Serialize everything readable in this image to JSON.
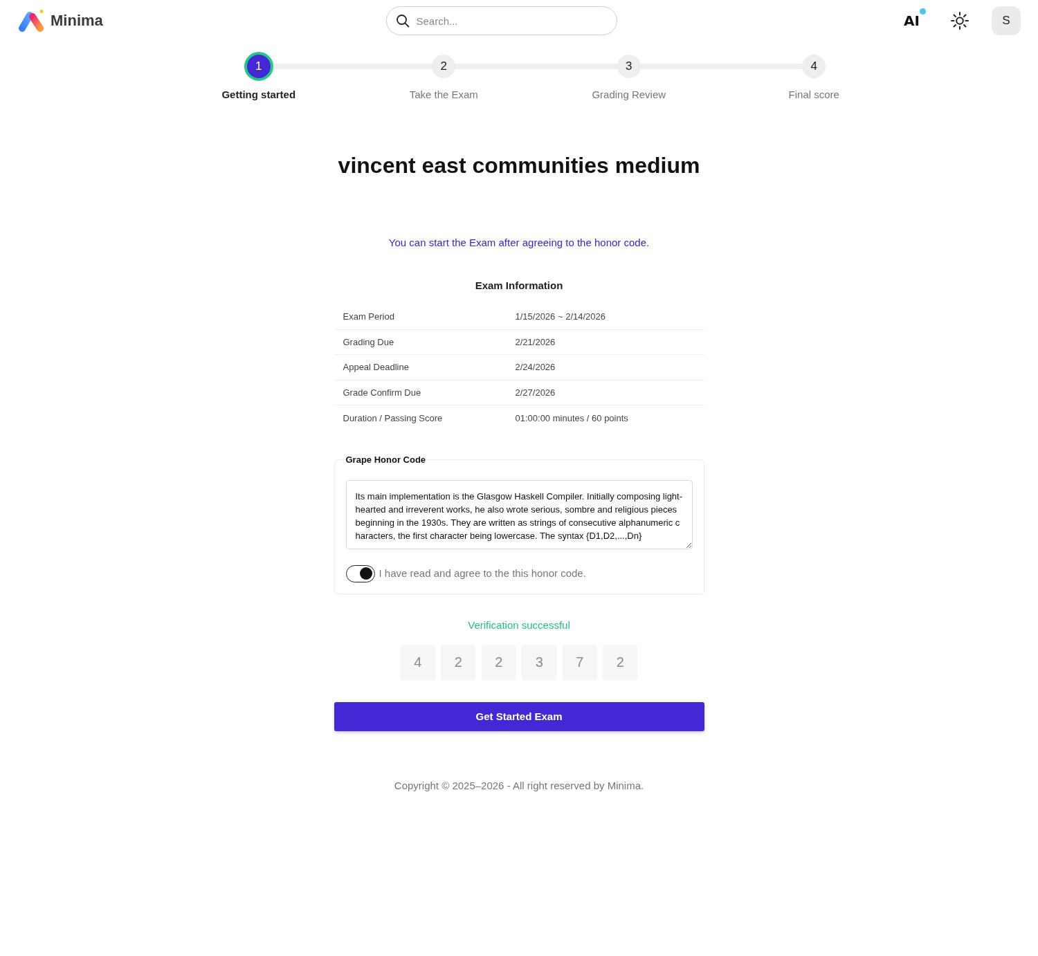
{
  "header": {
    "logo": "Minima",
    "search": {
      "placeholder": "Search..."
    },
    "ai": {
      "label": "AI",
      "notification": true
    },
    "avatar": "S"
  },
  "steps": [
    {
      "number": "1",
      "label": "Getting started",
      "selected": true
    },
    {
      "number": "2",
      "label": "Take the Exam",
      "selected": false
    },
    {
      "number": "3",
      "label": "Grading Review",
      "selected": false
    },
    {
      "number": "4",
      "label": "Final score",
      "selected": false
    }
  ],
  "title": "vincent east communities medium",
  "notice": "You can start the Exam after agreeing to the honor code.",
  "exam_information": {
    "heading": "Exam Information",
    "rows": [
      {
        "label": "Exam Period",
        "value": "1/15/2026 ~ 2/14/2026"
      },
      {
        "label": "Grading Due",
        "value": "2/21/2026"
      },
      {
        "label": "Appeal Deadline",
        "value": "2/24/2026"
      },
      {
        "label": "Grade Confirm Due",
        "value": "2/27/2026"
      },
      {
        "label": "Duration / Passing Score",
        "value": "01:00:00 minutes / 60 points"
      }
    ]
  },
  "honor_code": {
    "legend": "Grape Honor Code",
    "text": "Its main implementation is the Glasgow Haskell Compiler. Initially composing light-hearted and irreverent works, he also wrote serious, sombre and religious pieces beginning in the 1930s. They are written as strings of consecutive alphanumeric characters, the first character being lowercase. The syntax {D1,D2,...,Dn}",
    "agreement": {
      "label": "I have read and agree to the this honor code.",
      "checked": true
    }
  },
  "verification": {
    "message": "Verification successful",
    "digits": [
      "4",
      "2",
      "2",
      "3",
      "7",
      "2"
    ]
  },
  "start_button": "Get Started Exam",
  "footer": "Copyright © 2025–2026 - All right reserved by Minima."
}
